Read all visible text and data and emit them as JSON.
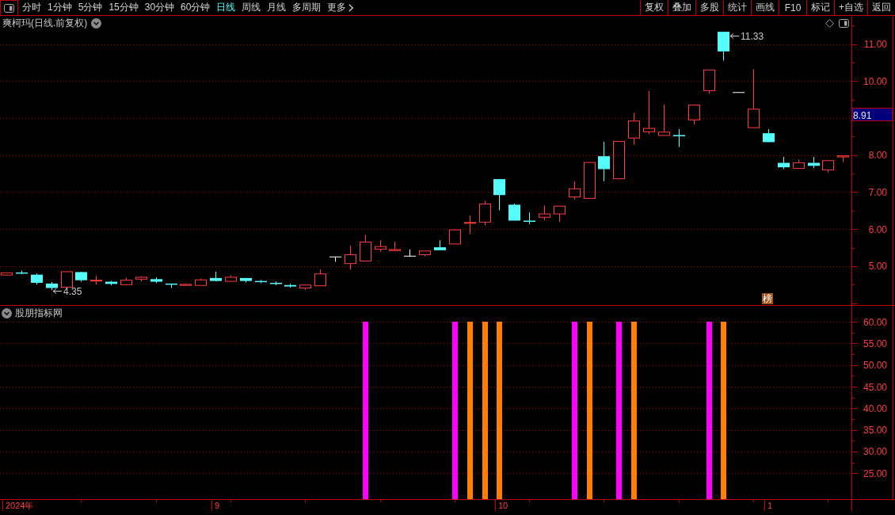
{
  "toolbar": {
    "periods": [
      {
        "label": "分时",
        "selected": false
      },
      {
        "label": "1分钟",
        "selected": false
      },
      {
        "label": "5分钟",
        "selected": false
      },
      {
        "label": "15分钟",
        "selected": false
      },
      {
        "label": "30分钟",
        "selected": false
      },
      {
        "label": "60分钟",
        "selected": false
      },
      {
        "label": "日线",
        "selected": true
      },
      {
        "label": "周线",
        "selected": false
      },
      {
        "label": "月线",
        "selected": false
      },
      {
        "label": "多周期",
        "selected": false
      }
    ],
    "more_menu": {
      "label": "更多"
    },
    "actions": [
      "复权",
      "叠加",
      "多股",
      "统计",
      "画线",
      "F10",
      "标记",
      "+自选",
      "返回"
    ]
  },
  "price_pane": {
    "title": "爽柯玛(日线.前复权)",
    "cursor_price": "8.91",
    "badge": "榜",
    "chart_data": [
      {
        "type": "candlestick",
        "ohlc": [
          [
            4.76,
            4.82,
            4.75,
            4.82
          ],
          [
            4.83,
            4.88,
            4.78,
            4.82
          ],
          [
            4.77,
            4.8,
            4.5,
            4.55
          ],
          [
            4.53,
            4.57,
            4.35,
            4.41
          ],
          [
            4.43,
            4.85,
            4.43,
            4.85
          ],
          [
            4.84,
            4.85,
            4.58,
            4.62
          ],
          [
            4.61,
            4.75,
            4.5,
            4.62
          ],
          [
            4.58,
            4.6,
            4.48,
            4.52
          ],
          [
            4.5,
            4.69,
            4.48,
            4.62
          ],
          [
            4.65,
            4.73,
            4.59,
            4.7
          ],
          [
            4.65,
            4.7,
            4.54,
            4.58
          ],
          [
            4.53,
            4.53,
            4.41,
            4.5
          ],
          [
            4.48,
            4.53,
            4.48,
            4.51
          ],
          [
            4.48,
            4.67,
            4.48,
            4.63
          ],
          [
            4.68,
            4.85,
            4.59,
            4.6
          ],
          [
            4.59,
            4.75,
            4.59,
            4.7
          ],
          [
            4.68,
            4.68,
            4.56,
            4.6
          ],
          [
            4.6,
            4.63,
            4.54,
            4.58
          ],
          [
            4.55,
            4.59,
            4.48,
            4.54
          ],
          [
            4.49,
            4.52,
            4.42,
            4.45
          ],
          [
            4.41,
            4.5,
            4.36,
            4.49
          ],
          [
            4.47,
            4.91,
            4.47,
            4.79
          ],
          [
            5.25,
            5.25,
            5.12,
            5.25
          ],
          [
            5.07,
            5.56,
            4.9,
            5.31
          ],
          [
            5.14,
            5.84,
            5.14,
            5.65
          ],
          [
            5.46,
            5.7,
            5.39,
            5.53
          ],
          [
            5.42,
            5.66,
            5.42,
            5.45
          ],
          [
            5.27,
            5.45,
            5.27,
            5.27
          ],
          [
            5.31,
            5.41,
            5.27,
            5.41
          ],
          [
            5.51,
            5.7,
            5.43,
            5.43
          ],
          [
            5.6,
            5.99,
            5.6,
            5.98
          ],
          [
            6.17,
            6.37,
            5.87,
            6.18
          ],
          [
            6.19,
            6.77,
            6.1,
            6.68
          ],
          [
            7.35,
            7.35,
            6.51,
            6.92
          ],
          [
            6.66,
            6.69,
            6.23,
            6.23
          ],
          [
            6.23,
            6.45,
            6.13,
            6.22
          ],
          [
            6.32,
            6.64,
            6.24,
            6.41
          ],
          [
            6.41,
            6.63,
            6.19,
            6.62
          ],
          [
            6.87,
            7.29,
            6.8,
            7.09
          ],
          [
            6.83,
            7.8,
            6.83,
            7.8
          ],
          [
            7.97,
            8.36,
            7.29,
            7.62
          ],
          [
            7.36,
            8.37,
            7.36,
            8.37
          ],
          [
            8.46,
            9.14,
            8.28,
            8.92
          ],
          [
            8.63,
            9.73,
            8.57,
            8.72
          ],
          [
            8.53,
            9.37,
            8.53,
            8.62
          ],
          [
            8.54,
            8.7,
            8.22,
            8.53
          ],
          [
            8.95,
            9.36,
            8.83,
            9.35
          ],
          [
            9.74,
            10.3,
            9.66,
            10.3
          ],
          [
            11.33,
            11.33,
            10.55,
            10.8
          ],
          [
            9.69,
            9.69,
            9.69,
            9.69
          ],
          [
            8.74,
            10.32,
            8.74,
            9.24
          ],
          [
            8.59,
            8.7,
            8.35,
            8.35
          ],
          [
            7.79,
            7.95,
            7.62,
            7.67
          ],
          [
            7.64,
            7.88,
            7.64,
            7.79
          ],
          [
            7.79,
            7.95,
            7.65,
            7.71
          ],
          [
            7.6,
            7.85,
            7.53,
            7.85
          ],
          [
            7.95,
            7.98,
            7.81,
            7.98
          ]
        ],
        "ylim": [
          3.95,
          11.76
        ],
        "yticks": [
          {
            "value": 5,
            "label": "5.00"
          },
          {
            "value": 6,
            "label": "6.00"
          },
          {
            "value": 7,
            "label": "7.00"
          },
          {
            "value": 8,
            "label": "8.00"
          },
          {
            "value": 10,
            "label": "10.00"
          },
          {
            "value": 11,
            "label": "11.00"
          }
        ],
        "grid": true,
        "annotations": [
          "11.33",
          "4.35"
        ]
      }
    ]
  },
  "indicator_pane": {
    "title": "股朋指标网",
    "chart_data": [
      {
        "type": "bar",
        "categories": [
          "2024年",
          null,
          null,
          null,
          null,
          null,
          null,
          null,
          null,
          null,
          null,
          null,
          null,
          null,
          "9",
          null,
          null,
          null,
          null,
          null,
          null,
          null,
          null,
          null,
          null,
          null,
          null,
          null,
          null,
          null,
          null,
          null,
          null,
          "10",
          null,
          null,
          null,
          null,
          null,
          null,
          null,
          null,
          null,
          null,
          null,
          null,
          null,
          null,
          null,
          null,
          null,
          "1",
          null,
          null,
          null,
          null,
          null
        ],
        "series": [
          {
            "color": "#ff00ff",
            "values": [
              null,
              null,
              null,
              null,
              null,
              null,
              null,
              null,
              null,
              null,
              null,
              null,
              null,
              null,
              null,
              null,
              null,
              null,
              null,
              null,
              null,
              null,
              null,
              null,
              60,
              null,
              null,
              null,
              null,
              null,
              60,
              null,
              null,
              null,
              null,
              null,
              null,
              null,
              60,
              null,
              null,
              60,
              null,
              null,
              null,
              null,
              null,
              60,
              null,
              null,
              null,
              null,
              null,
              null,
              null,
              null,
              null
            ]
          },
          {
            "color": "#ff8000",
            "values": [
              null,
              null,
              null,
              null,
              null,
              null,
              null,
              null,
              null,
              null,
              null,
              null,
              null,
              null,
              null,
              null,
              null,
              null,
              null,
              null,
              null,
              null,
              null,
              null,
              null,
              null,
              null,
              null,
              null,
              null,
              null,
              60,
              60,
              60,
              null,
              null,
              null,
              null,
              null,
              60,
              null,
              null,
              60,
              null,
              null,
              null,
              null,
              null,
              60,
              null,
              null,
              null,
              null,
              null,
              null,
              null,
              null
            ]
          }
        ],
        "ylim": [
          19,
          63.7
        ],
        "yticks": [
          {
            "value": 25,
            "label": "25.00"
          },
          {
            "value": 30,
            "label": "30.00"
          },
          {
            "value": 35,
            "label": "35.00"
          },
          {
            "value": 40,
            "label": "40.00"
          },
          {
            "value": 45,
            "label": "45.00"
          },
          {
            "value": 50,
            "label": "50.00"
          },
          {
            "value": 55,
            "label": "55.00"
          },
          {
            "value": 60,
            "label": "60.00"
          }
        ],
        "grid": true
      }
    ]
  }
}
